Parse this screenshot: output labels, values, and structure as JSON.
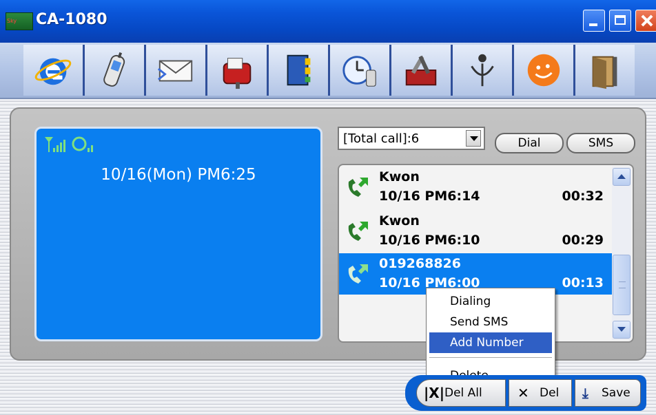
{
  "window": {
    "title": "CA-1080"
  },
  "toolbar": {
    "icons": [
      "internet-explorer-icon",
      "mobile-phone-icon",
      "email-icon",
      "mailbox-icon",
      "address-book-icon",
      "clock-phone-icon",
      "tools-icon",
      "logo-icon",
      "smiley-icon",
      "exit-door-icon"
    ]
  },
  "lcd": {
    "datetime": "10/16(Mon) PM6:25"
  },
  "filter": {
    "value": "[Total call]:6"
  },
  "tabs": {
    "dial": "Dial",
    "sms": "SMS"
  },
  "calls": [
    {
      "name": "Kwon",
      "date": "10/16 PM6:14",
      "duration": "00:32"
    },
    {
      "name": "Kwon",
      "date": "10/16 PM6:10",
      "duration": "00:29"
    },
    {
      "name": "019268826",
      "date": "10/16 PM6:00",
      "duration": "00:13"
    }
  ],
  "menu": {
    "dialing": "Dialing",
    "send_sms": "Send SMS",
    "add_number": "Add Number",
    "delete": "Delete"
  },
  "buttons": {
    "del_all": "Del All",
    "del": "Del",
    "save": "Save"
  },
  "colors": {
    "lcd": "#0a7ff0",
    "selection": "#0a7ff0",
    "menu_highlight": "#2f5fc5",
    "title_bar": "#0a55d8"
  }
}
